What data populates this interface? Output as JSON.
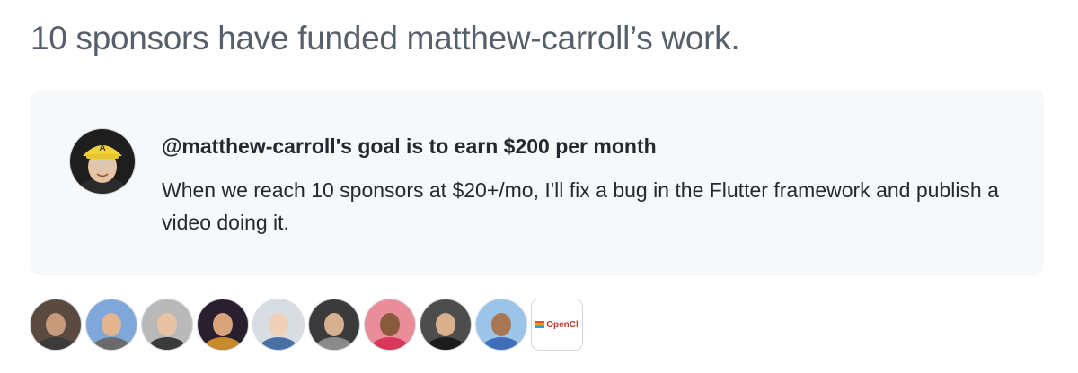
{
  "headline": "10 sponsors have funded matthew-carroll’s work.",
  "goal": {
    "title": "@matthew-carroll's goal is to earn $200 per month",
    "description": "When we reach 10 sponsors at $20+/mo, I'll fix a bug in the Flutter framework and publish a video doing it."
  },
  "sponsors": [
    {
      "type": "avatar",
      "bg": "#5a4a40",
      "skin": "#c69a7a",
      "shirt": "#3b3b3b"
    },
    {
      "type": "avatar",
      "bg": "#7fa7d9",
      "skin": "#e2b58f",
      "shirt": "#6b6b6b"
    },
    {
      "type": "avatar",
      "bg": "#b9b9b9",
      "skin": "#e7c3a4",
      "shirt": "#3a3a3a"
    },
    {
      "type": "avatar",
      "bg": "#2a1f2e",
      "skin": "#d9a47a",
      "shirt": "#c98a2e"
    },
    {
      "type": "avatar",
      "bg": "#d8dde3",
      "skin": "#f0d0b6",
      "shirt": "#4a6fa5"
    },
    {
      "type": "avatar",
      "bg": "#3b3b3b",
      "skin": "#d7b08f",
      "shirt": "#8a8a8a"
    },
    {
      "type": "avatar",
      "bg": "#e98d9a",
      "skin": "#8a5a3c",
      "shirt": "#d8365a"
    },
    {
      "type": "avatar",
      "bg": "#4d4d4d",
      "skin": "#d9b08c",
      "shirt": "#1c1c1c"
    },
    {
      "type": "avatar",
      "bg": "#9cc3e8",
      "skin": "#a87652",
      "shirt": "#3f6fb8"
    },
    {
      "type": "org",
      "label": "OpenCl"
    }
  ],
  "colors": {
    "card_bg": "#f6f8fa",
    "headline": "#57606a",
    "text": "#24292f"
  }
}
